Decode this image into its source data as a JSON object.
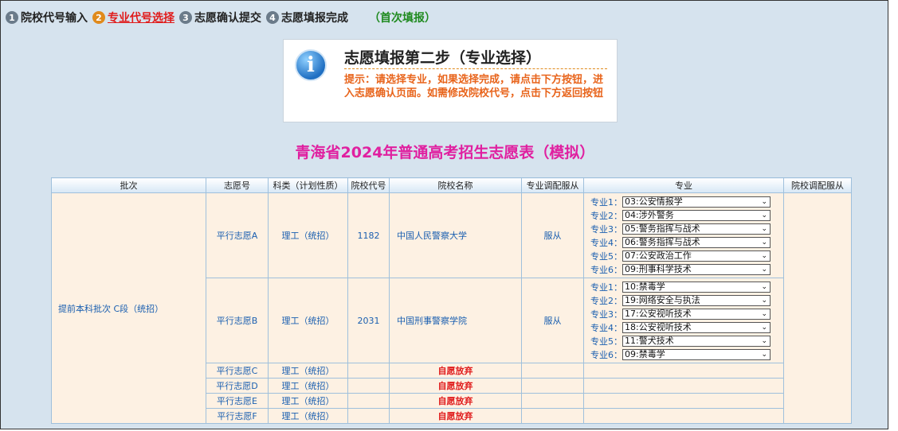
{
  "steps": [
    {
      "num": "1",
      "label": "院校代号输入",
      "active": false
    },
    {
      "num": "2",
      "label": "专业代号选择",
      "active": true
    },
    {
      "num": "3",
      "label": "志愿确认提交",
      "active": false
    },
    {
      "num": "4",
      "label": "志愿填报完成",
      "active": false
    }
  ],
  "first_fill": "（首次填报）",
  "notice": {
    "icon": "info-icon",
    "icon_glyph": "i",
    "title": "志愿填报第二步（专业选择）",
    "text": "提示：请选择专业，如果选择完成，请点击下方按钮，进入志愿确认页面。如需修改院校代号，点击下方返回按钮"
  },
  "form_title": "青海省2024年普通高考招生志愿表（模拟）",
  "table": {
    "headers": [
      "批次",
      "志愿号",
      "科类（计划性质）",
      "院校代号",
      "院校名称",
      "专业调配服从",
      "专业",
      "院校调配服从"
    ],
    "batch": "提前本科批次 C段（统招）",
    "rows": [
      {
        "vol": "平行志愿A",
        "type": "理工（统招）",
        "code": "1182",
        "school": "中国人民警察大学",
        "adjust": "服从",
        "majors": [
          {
            "label": "专业1：",
            "value": "03:公安情报学"
          },
          {
            "label": "专业2：",
            "value": "04:涉外警务"
          },
          {
            "label": "专业3：",
            "value": "05:警务指挥与战术"
          },
          {
            "label": "专业4：",
            "value": "06:警务指挥与战术"
          },
          {
            "label": "专业5：",
            "value": "07:公安政治工作"
          },
          {
            "label": "专业6：",
            "value": "09:刑事科学技术"
          }
        ]
      },
      {
        "vol": "平行志愿B",
        "type": "理工（统招）",
        "code": "2031",
        "school": "中国刑事警察学院",
        "adjust": "服从",
        "majors": [
          {
            "label": "专业1：",
            "value": "10:禁毒学"
          },
          {
            "label": "专业2：",
            "value": "19:网络安全与执法"
          },
          {
            "label": "专业3：",
            "value": "17:公安视听技术"
          },
          {
            "label": "专业4：",
            "value": "18:公安视听技术"
          },
          {
            "label": "专业5：",
            "value": "11:警犬技术"
          },
          {
            "label": "专业6：",
            "value": "09:禁毒学"
          }
        ]
      },
      {
        "vol": "平行志愿C",
        "type": "理工（统招）",
        "status": "自愿放弃"
      },
      {
        "vol": "平行志愿D",
        "type": "理工（统招）",
        "status": "自愿放弃"
      },
      {
        "vol": "平行志愿E",
        "type": "理工（统招）",
        "status": "自愿放弃"
      },
      {
        "vol": "平行志愿F",
        "type": "理工（统招）",
        "status": "自愿放弃"
      }
    ]
  }
}
